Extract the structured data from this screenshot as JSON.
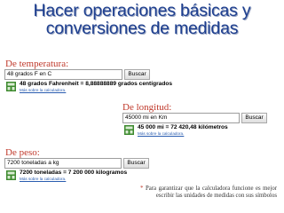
{
  "title": {
    "line1": "Hacer operaciones básicas y",
    "line2": "conversiones de medidas"
  },
  "temperature": {
    "label": "De temperatura:",
    "query": "48 grados F en C",
    "search_label": "Buscar",
    "result": "48 grados Fahrenheit = 8,88888889 grados centígrados",
    "more_link": "Más sobre la calculadora."
  },
  "length": {
    "label": "De longitud:",
    "query": "45000 mi en Km",
    "search_label": "Buscar",
    "result": "45 000 mi = 72 420,48 kilómetros",
    "more_link": "Más sobre la calculadora."
  },
  "weight": {
    "label": "De peso:",
    "query": "7200 toneladas a kg",
    "search_label": "Buscar",
    "result": "7200 toneladas = 7 200 000 kilogramos",
    "more_link": "Más sobre la calculadora."
  },
  "footnote": {
    "marker": "*",
    "text": "Para garantizar que la calculadora funcione es mejor escribir las unidades de medidas con sus símbolos"
  },
  "colors": {
    "title": "#1e3f8f",
    "label": "#c0392b",
    "link": "#2a5db0",
    "calc_icon": "#3d8a2e"
  }
}
